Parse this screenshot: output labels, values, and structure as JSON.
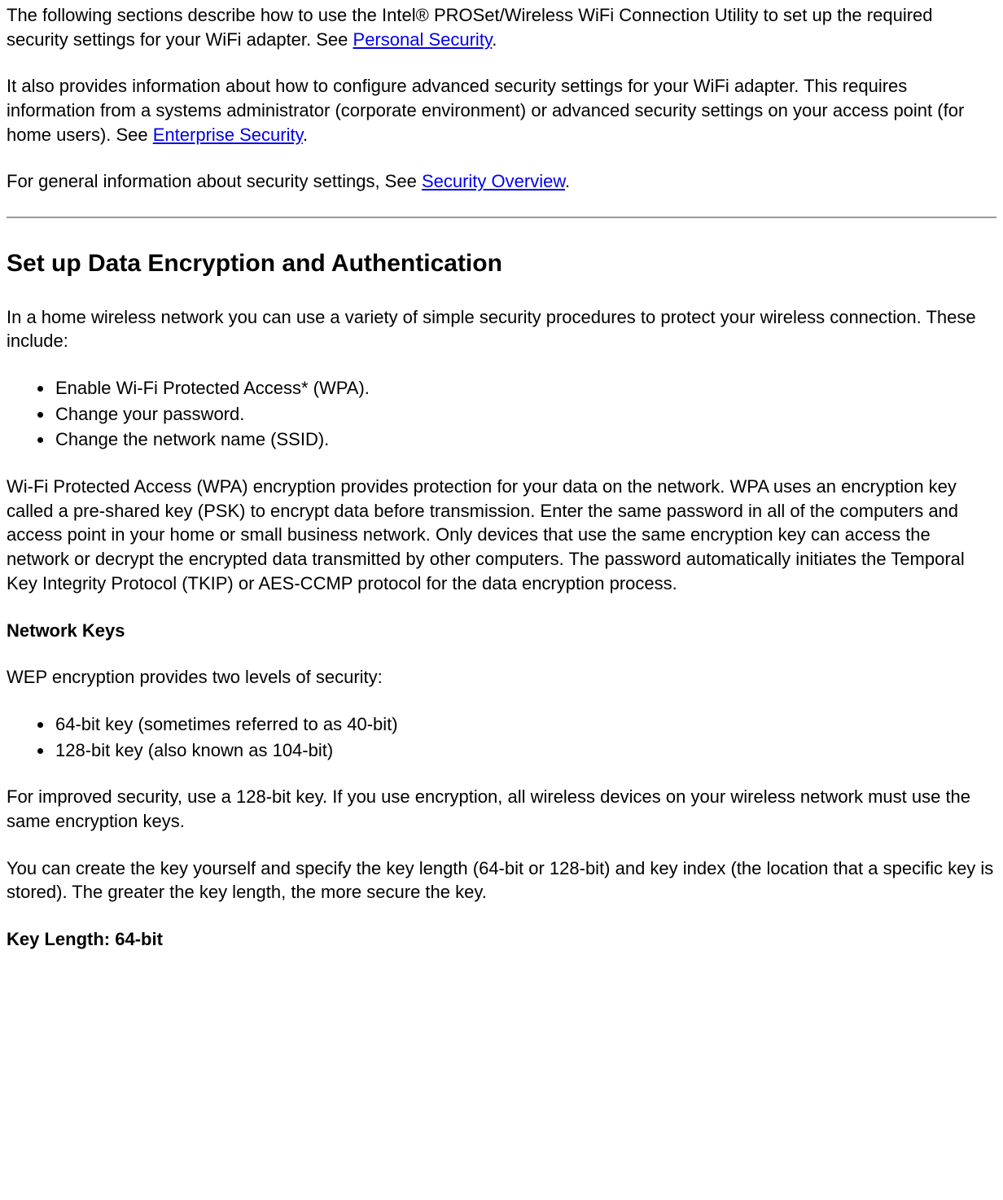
{
  "intro": {
    "p1_a": "The following sections describe how to use the Intel® PROSet/Wireless WiFi Connection Utility to set up the required security settings for your WiFi adapter. See ",
    "p1_link": "Personal Security",
    "p1_b": ".",
    "p2_a": "It also provides information about how to configure advanced security settings for your WiFi adapter. This requires information from a systems administrator (corporate environment) or advanced security settings on your access point (for home users). See ",
    "p2_link": "Enterprise Security",
    "p2_b": ".",
    "p3_a": "For general information about security settings, See ",
    "p3_link": "Security Overview",
    "p3_b": "."
  },
  "section": {
    "heading": "Set up Data Encryption and Authentication",
    "p1": "In a home wireless network you can use a variety of simple security procedures to protect your wireless connection. These include:",
    "list1": [
      "Enable Wi-Fi Protected Access* (WPA).",
      "Change your password.",
      "Change the network name (SSID)."
    ],
    "p2": "Wi-Fi Protected Access (WPA) encryption provides protection for your data on the network. WPA uses an encryption key called a pre-shared key (PSK) to encrypt data before transmission. Enter the same password in all of the computers and access point in your home or small business network. Only devices that use the same encryption key can access the network or decrypt the encrypted data transmitted by other computers. The password automatically initiates the Temporal Key Integrity Protocol (TKIP) or AES-CCMP protocol for the data encryption process.",
    "sub1": "Network Keys",
    "p3": "WEP encryption provides two levels of security:",
    "list2": [
      "64-bit key (sometimes referred to as 40-bit)",
      "128-bit key (also known as 104-bit)"
    ],
    "p4": "For improved security, use a 128-bit key. If you use encryption, all wireless devices on your wireless network must use the same encryption keys.",
    "p5": "You can create the key yourself and specify the key length (64-bit or 128-bit) and key index (the location that a specific key is stored). The greater the key length, the more secure the key.",
    "sub2": "Key Length: 64-bit"
  }
}
